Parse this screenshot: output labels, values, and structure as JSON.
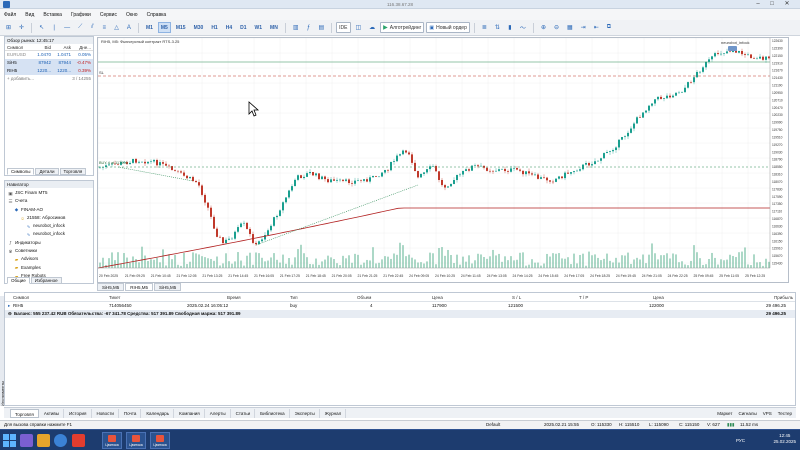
{
  "window": {
    "title": "116.38.67.28"
  },
  "menu": [
    "Файл",
    "Вид",
    "Вставка",
    "Графики",
    "Сервис",
    "Окно",
    "Справка"
  ],
  "toolbar": {
    "timeframes": [
      "M1",
      "M5",
      "M15",
      "M30",
      "H1",
      "H4",
      "D1",
      "W1",
      "MN"
    ],
    "selected_timeframe": "M5",
    "ide": "IDE",
    "algo": "Алготрейдинг",
    "new_order": "Новый ордер"
  },
  "market_watch": {
    "title": "Обзор рынка: 12:45:17",
    "columns": [
      "Символ",
      "Bid",
      "Ask",
      "Дне..."
    ],
    "rows": [
      {
        "symbol": "EURUSD",
        "bid": "1.0470",
        "ask": "1.0471",
        "change": "0.05%",
        "dir": "gray"
      },
      {
        "symbol": "SiH5",
        "bid": "87942",
        "ask": "87944",
        "change": "-0.47%",
        "dir": "dn"
      },
      {
        "symbol": "RIH5",
        "bid": "1220...",
        "ask": "1220...",
        "change": "0.39%",
        "dir": "dn"
      }
    ],
    "add_label": "+ добавить...",
    "count": "3 / 14255",
    "tabs": [
      "Символы",
      "Детали",
      "Торговля"
    ]
  },
  "navigator": {
    "title": "Навигатор",
    "items": [
      {
        "label": "JSC Finam MT5",
        "level": 0,
        "icon": "terminal-icon"
      },
      {
        "label": "Счета",
        "level": 0,
        "icon": "accounts-icon"
      },
      {
        "label": "FINAM-AO",
        "level": 1,
        "icon": "server-icon"
      },
      {
        "label": "21558: Абросимов",
        "level": 2,
        "icon": "user-icon"
      },
      {
        "label": "neurobot_infock",
        "level": 3,
        "icon": "indicator-icon"
      },
      {
        "label": "neurobot_infock",
        "level": 3,
        "icon": "indicator-icon"
      },
      {
        "label": "Индикаторы",
        "level": 0,
        "icon": "indicators-icon"
      },
      {
        "label": "Советники",
        "level": 0,
        "icon": "experts-icon"
      },
      {
        "label": "Advisors",
        "level": 1,
        "icon": "folder-icon"
      },
      {
        "label": "Examples",
        "level": 1,
        "icon": "folder-icon"
      },
      {
        "label": "Free Robots",
        "level": 1,
        "icon": "folder-icon"
      }
    ],
    "tabs": [
      "Общие",
      "Избранное"
    ]
  },
  "chart": {
    "header": "RIH5, M5: Фьючерсный контракт RTS-3.25",
    "label_sl": "SL",
    "price_tag": "BUY 4 at 117900",
    "ea_label": "neurobot_infock",
    "price_axis": [
      "122630",
      "122390",
      "122150",
      "121910",
      "121670",
      "121430",
      "121190",
      "120950",
      "120710",
      "120470",
      "120230",
      "119990",
      "119750",
      "119510",
      "119270",
      "119030",
      "118790",
      "118550",
      "118310",
      "118070",
      "117830",
      "117590",
      "117350",
      "117110",
      "116870",
      "116630",
      "116390",
      "116150",
      "115910",
      "115670",
      "115430"
    ],
    "time_axis": [
      "20 Feb 2025",
      "21 Feb 09:25",
      "21 Feb 10:45",
      "21 Feb 12:05",
      "21 Feb 13:25",
      "21 Feb 14:45",
      "21 Feb 16:05",
      "21 Feb 17:25",
      "21 Feb 18:45",
      "21 Feb 20:05",
      "21 Feb 21:25",
      "21 Feb 22:45",
      "24 Feb 09:05",
      "24 Feb 10:25",
      "24 Feb 11:45",
      "24 Feb 13:05",
      "24 Feb 14:25",
      "24 Feb 15:45",
      "24 Feb 17:05",
      "24 Feb 18:25",
      "24 Feb 19:45",
      "24 Feb 21:05",
      "24 Feb 22:25",
      "25 Feb 09:45",
      "25 Feb 11:05",
      "25 Feb 12:25"
    ],
    "tabs": [
      "SiH5,M5",
      "RIH5,M5",
      "SiH5,M5"
    ],
    "colors": {
      "up": "#1a9f8f",
      "down": "#c0392b",
      "ma": "#b22222",
      "level": "#2e8b57"
    }
  },
  "trade": {
    "columns": [
      "Символ",
      "Тикет",
      "Время",
      "Тип",
      "Объем",
      "Цена",
      "S / L",
      "T / P",
      "Цена",
      "Прибыль"
    ],
    "position": {
      "symbol": "RIH5",
      "ticket": "714056450",
      "time": "2025.02.24 16:05:12",
      "type": "buy",
      "volume": "4",
      "price": "117900",
      "sl": "121500",
      "tp": "",
      "current": "122000",
      "profit": "29 496.25"
    },
    "balance_line": "Баланс: 555 237.42 RUB  Обязательства: -67 341.78  Средства: 517 391.89  Свободная маржа: 517 391.89",
    "balance_profit": "29 496.25",
    "tabs": [
      "Торговля",
      "Активы",
      "История",
      "Новости",
      "Почта",
      "Календарь",
      "Компания",
      "Алерты",
      "Статьи",
      "Библиотека",
      "Эксперты",
      "Журнал"
    ],
    "right": [
      "Маркет",
      "Сигналы",
      "VPS",
      "Тестер"
    ],
    "side_label": "Инструменты"
  },
  "status": {
    "help": "Для вызова справки нажмите F1",
    "profile": "Default",
    "time": "2025.02.21 15:55",
    "o": "O: 115330",
    "h": "H: 115510",
    "l": "L: 115090",
    "c": "C: 115150",
    "v": "V: 627",
    "conn": "11.52 ms"
  },
  "taskbar": {
    "apps": [
      "Цвитока",
      "Цвитока",
      "Цвитока"
    ],
    "time": "12:45",
    "date": "25.02.2025",
    "lang": "РУС"
  }
}
